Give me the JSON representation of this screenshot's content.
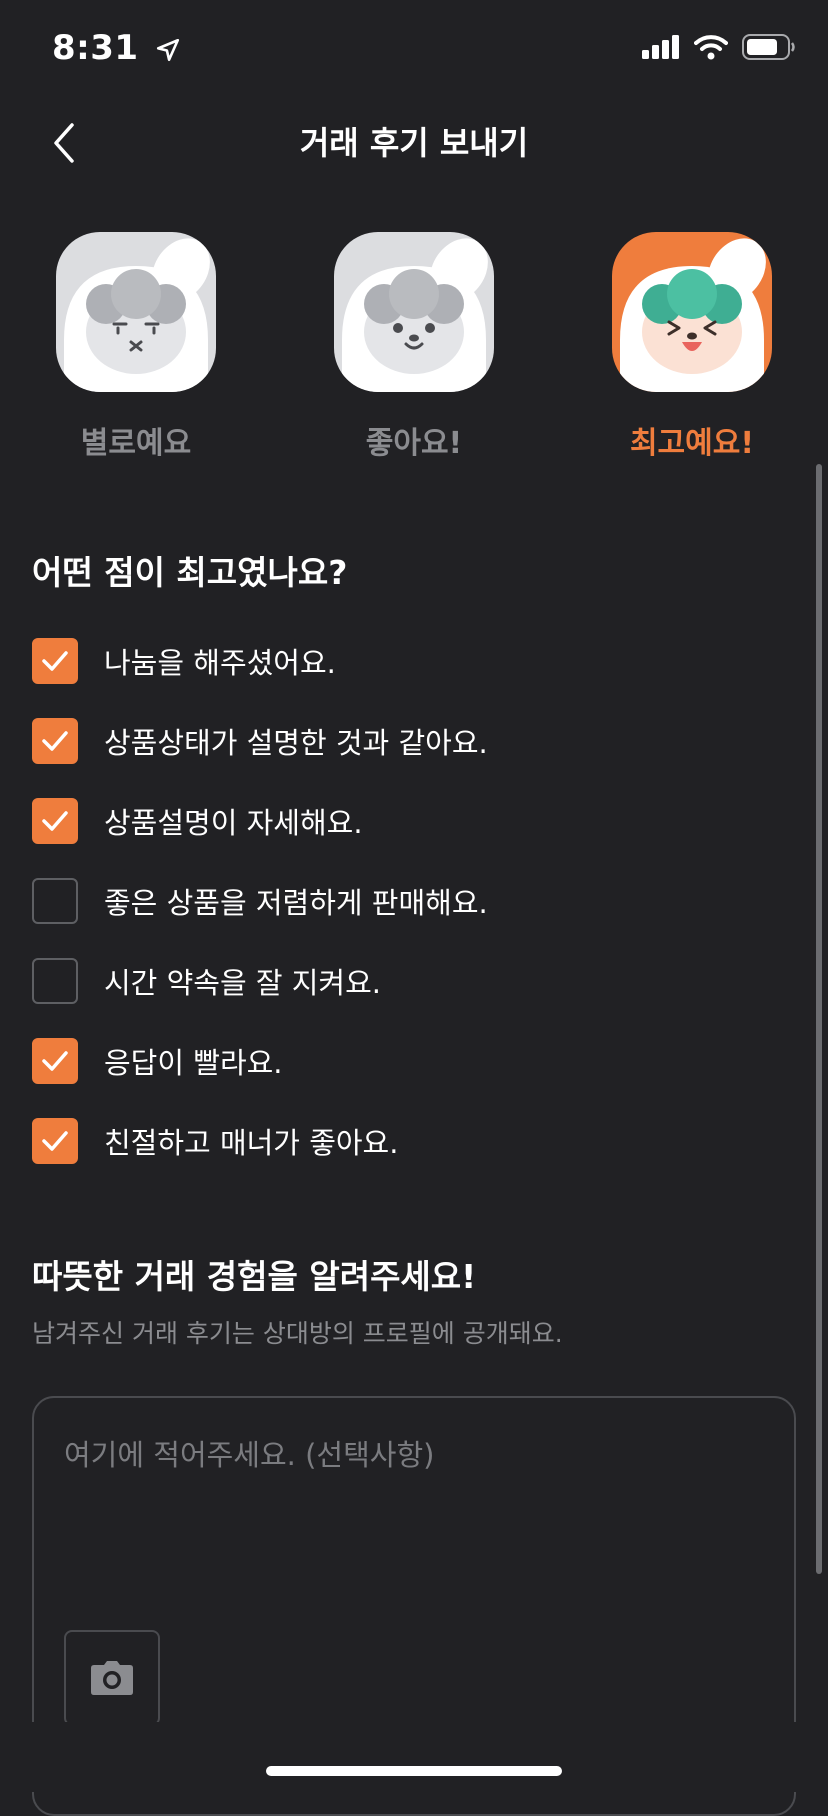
{
  "status_bar": {
    "time": "8:31"
  },
  "header": {
    "title": "거래 후기 보내기"
  },
  "ratings": [
    {
      "label": "별로예요",
      "selected": false
    },
    {
      "label": "좋아요!",
      "selected": false
    },
    {
      "label": "최고예요!",
      "selected": true
    }
  ],
  "question": {
    "title": "어떤 점이 최고였나요?",
    "items": [
      {
        "label": "나눔을 해주셨어요.",
        "checked": true
      },
      {
        "label": "상품상태가 설명한 것과 같아요.",
        "checked": true
      },
      {
        "label": "상품설명이 자세해요.",
        "checked": true
      },
      {
        "label": "좋은 상품을 저렴하게 판매해요.",
        "checked": false
      },
      {
        "label": "시간 약속을 잘 지켜요.",
        "checked": false
      },
      {
        "label": "응답이 빨라요.",
        "checked": true
      },
      {
        "label": "친절하고 매너가 좋아요.",
        "checked": true
      }
    ]
  },
  "review": {
    "title": "따뜻한 거래 경험을 알려주세요!",
    "subtitle": "남겨주신 거래 후기는 상대방의 프로필에 공개돼요.",
    "placeholder": "여기에 적어주세요. (선택사항)"
  },
  "colors": {
    "accent": "#ef7d3d",
    "background": "#212124",
    "muted_text": "#8b8c90"
  },
  "icons": {
    "location": "location-arrow-icon",
    "back": "chevron-left-icon",
    "camera": "camera-icon"
  }
}
